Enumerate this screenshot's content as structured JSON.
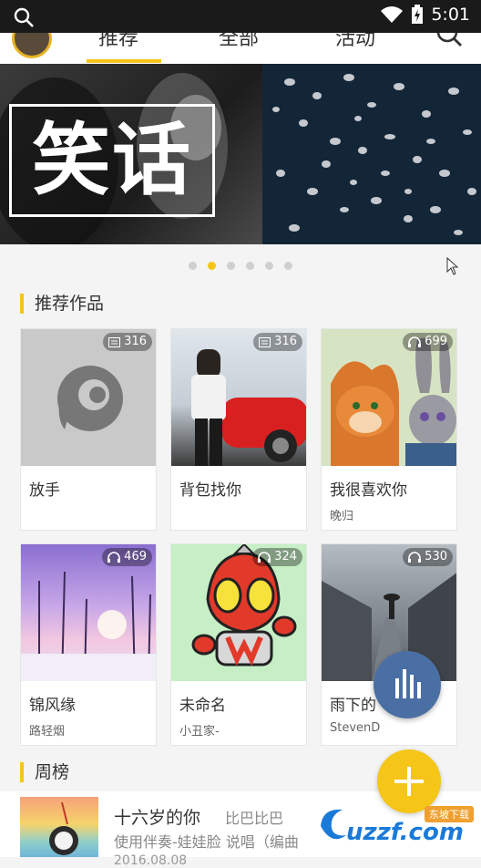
{
  "status_bar": {
    "time": "5:01"
  },
  "tabs": [
    {
      "label": "推荐"
    },
    {
      "label": "全部"
    },
    {
      "label": "活动"
    }
  ],
  "banner": {
    "title": "笑话",
    "dot_count": 6,
    "active_dot": 1
  },
  "section_recommended": {
    "title": "推荐作品"
  },
  "cards": [
    {
      "title": "放手",
      "author": "",
      "count": "316",
      "count_icon": "lyrics-icon"
    },
    {
      "title": "背包找你",
      "author": "",
      "count": "316",
      "count_icon": "lyrics-icon"
    },
    {
      "title": "我很喜欢你",
      "author": "晚归",
      "count": "699",
      "count_icon": "headphones-icon"
    },
    {
      "title": "锦风缘",
      "author": "路轻烟",
      "count": "469",
      "count_icon": "headphones-icon"
    },
    {
      "title": "未命名",
      "author": "小丑家-",
      "count": "324",
      "count_icon": "headphones-icon"
    },
    {
      "title": "雨下的",
      "author": "StevenD",
      "count": "530",
      "count_icon": "headphones-icon"
    }
  ],
  "section_weekly": {
    "title": "周榜"
  },
  "weekly_item": {
    "title": "十六岁的你",
    "author": "比巴比巴",
    "subtitle": "使用伴奏-娃娃脸 说唱（编曲",
    "date": "2016.08.08"
  },
  "watermark": {
    "text": "uzzf.com",
    "tag": "东坡下载"
  },
  "colors": {
    "accent": "#f5c518",
    "fab_music": "#4a6fa5"
  }
}
